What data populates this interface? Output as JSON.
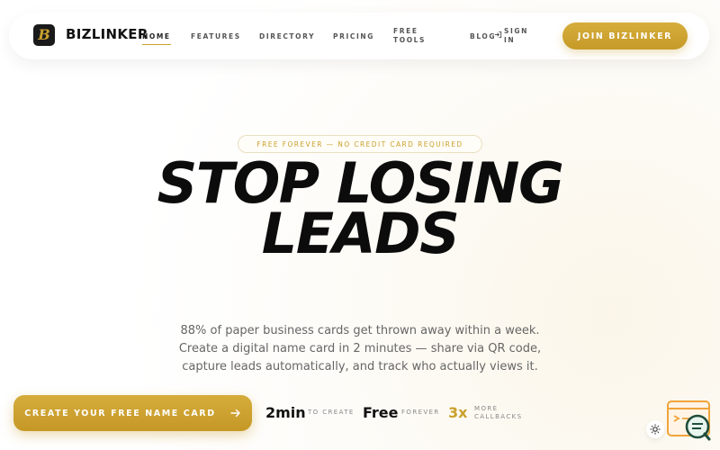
{
  "nav": {
    "brand": "BIZLINKER",
    "links": [
      "HOME",
      "FEATURES",
      "DIRECTORY",
      "PRICING",
      "FREE TOOLS",
      "BLOG"
    ],
    "signin": "SIGN IN",
    "join": "JOIN BIZLINKER"
  },
  "hero": {
    "badge": "FREE FOREVER — NO CREDIT CARD REQUIRED",
    "headline": "STOP LOSING LEADS",
    "subtitle": "88% of paper business cards get thrown away within a week. Create a digital name card in 2 minutes — share via QR code, capture leads automatically, and track who actually views it.",
    "cta": "CREATE YOUR FREE NAME CARD"
  },
  "stats": [
    {
      "value": "2min",
      "label": "TO CREATE"
    },
    {
      "value": "Free",
      "label": "FOREVER"
    },
    {
      "value": "3x",
      "label": "MORE CALLBACKS"
    }
  ],
  "icons": {
    "logo": "bizlinker-logo-icon",
    "signin": "sign-in-icon",
    "arrow": "arrow-right-icon",
    "theme": "sun-icon",
    "chat": "chat-widget-icon"
  },
  "colors": {
    "accent": "#c9a02d",
    "text": "#111111",
    "muted": "#666666",
    "logo_bg": "#1a1a1a"
  }
}
